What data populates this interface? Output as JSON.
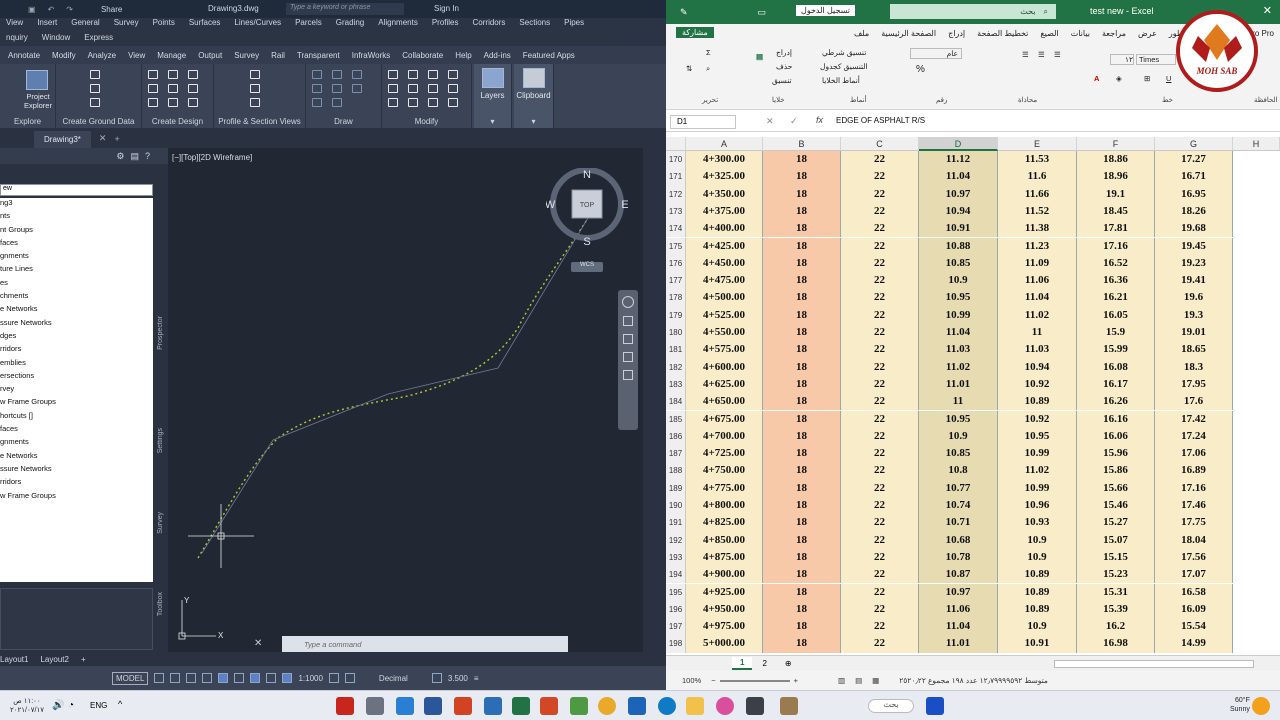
{
  "cad": {
    "doc_name": "Drawing3.dwg",
    "share": "Share",
    "search_placeholder": "Type a keyword or phrase",
    "sign_in": "Sign In",
    "menu_row1": [
      "View",
      "Insert",
      "General",
      "Survey",
      "Points",
      "Surfaces",
      "Lines/Curves",
      "Parcels",
      "Grading",
      "Alignments",
      "Profiles",
      "Corridors",
      "Sections",
      "Pipes"
    ],
    "menu_row2": [
      "nquiry",
      "Window",
      "Express"
    ],
    "ribbon_tabs": [
      "Annotate",
      "Modify",
      "Analyze",
      "View",
      "Manage",
      "Output",
      "Survey",
      "Rail",
      "Transparent",
      "InfraWorks",
      "Collaborate",
      "Help",
      "Add-ins",
      "Featured Apps"
    ],
    "project_explorer": "Project Explorer",
    "layers": "Layers",
    "clipboard": "Clipboard",
    "panels": [
      "Explore",
      "Create Ground Data",
      "Create Design",
      "Profile & Section Views",
      "Draw",
      "Modify"
    ],
    "doc_tab": "Drawing3*",
    "prospector_select": "ew",
    "tree": [
      "ng3",
      "nts",
      "nt Groups",
      "faces",
      "gnments",
      "ture Lines",
      "es",
      "chments",
      "e Networks",
      "ssure Networks",
      "dges",
      "rridors",
      "emblies",
      "ersections",
      "rvey",
      "w Frame Groups",
      "hortcuts []",
      "faces",
      "gnments",
      "e Networks",
      "ssure Networks",
      "rridors",
      "w Frame Groups"
    ],
    "side_labels": [
      "Prospector",
      "Settings",
      "Survey",
      "Toolbox"
    ],
    "viewport_label": "[−][Top][2D Wireframe]",
    "compass": {
      "n": "N",
      "s": "S",
      "e": "E",
      "w": "W",
      "top": "TOP",
      "wcs": "WCS"
    },
    "ucs": {
      "x": "X",
      "y": "Y"
    },
    "command_placeholder": "Type a command",
    "layout_tabs": [
      "Layout1",
      "Layout2"
    ],
    "status": {
      "model": "MODEL",
      "scale": "1:1000",
      "units": "Decimal",
      "value": "3.500"
    }
  },
  "excel": {
    "sign_in": "تسجيل الدخول",
    "search": "بحث",
    "file_name": "test new  -  Excel",
    "share": "مشاركة",
    "tabs": [
      "ملف",
      "الصفحة الرئيسية",
      "إدراج",
      "تخطيط الصفحة",
      "الصيغ",
      "بيانات",
      "مراجعة",
      "عرض",
      "المطور",
      "تعليمات",
      "Nitro Pro"
    ],
    "ribbon": {
      "insert": "إدراج",
      "delete": "حذف",
      "format": "تنسيق",
      "cond": "تنسيق شرطي",
      "table": "التنسيق كجدول",
      "styles": "أنماط الخلايا",
      "general": "عام",
      "font": "Times",
      "size": "١٢"
    },
    "groups": [
      "تحرير",
      "خلايا",
      "أنماط",
      "رقم",
      "محاذاة",
      "خط",
      "الحافظة"
    ],
    "name_box": "D1",
    "formula": "EDGE OF ASPHALT R/S",
    "columns": [
      "A",
      "B",
      "C",
      "D",
      "E",
      "F",
      "G",
      "H"
    ],
    "selected_col": "D",
    "rows": [
      [
        "170",
        "4+300.00",
        "18",
        "22",
        "11.12",
        "11.53",
        "18.86",
        "17.27"
      ],
      [
        "171",
        "4+325.00",
        "18",
        "22",
        "11.04",
        "11.6",
        "18.96",
        "16.71"
      ],
      [
        "172",
        "4+350.00",
        "18",
        "22",
        "10.97",
        "11.66",
        "19.1",
        "16.95"
      ],
      [
        "173",
        "4+375.00",
        "18",
        "22",
        "10.94",
        "11.52",
        "18.45",
        "18.26"
      ],
      [
        "174",
        "4+400.00",
        "18",
        "22",
        "10.91",
        "11.38",
        "17.81",
        "19.68"
      ],
      [
        "175",
        "4+425.00",
        "18",
        "22",
        "10.88",
        "11.23",
        "17.16",
        "19.45"
      ],
      [
        "176",
        "4+450.00",
        "18",
        "22",
        "10.85",
        "11.09",
        "16.52",
        "19.23"
      ],
      [
        "177",
        "4+475.00",
        "18",
        "22",
        "10.9",
        "11.06",
        "16.36",
        "19.41"
      ],
      [
        "178",
        "4+500.00",
        "18",
        "22",
        "10.95",
        "11.04",
        "16.21",
        "19.6"
      ],
      [
        "179",
        "4+525.00",
        "18",
        "22",
        "10.99",
        "11.02",
        "16.05",
        "19.3"
      ],
      [
        "180",
        "4+550.00",
        "18",
        "22",
        "11.04",
        "11",
        "15.9",
        "19.01"
      ],
      [
        "181",
        "4+575.00",
        "18",
        "22",
        "11.03",
        "11.03",
        "15.99",
        "18.65"
      ],
      [
        "182",
        "4+600.00",
        "18",
        "22",
        "11.02",
        "10.94",
        "16.08",
        "18.3"
      ],
      [
        "183",
        "4+625.00",
        "18",
        "22",
        "11.01",
        "10.92",
        "16.17",
        "17.95"
      ],
      [
        "184",
        "4+650.00",
        "18",
        "22",
        "11",
        "10.89",
        "16.26",
        "17.6"
      ],
      [
        "185",
        "4+675.00",
        "18",
        "22",
        "10.95",
        "10.92",
        "16.16",
        "17.42"
      ],
      [
        "186",
        "4+700.00",
        "18",
        "22",
        "10.9",
        "10.95",
        "16.06",
        "17.24"
      ],
      [
        "187",
        "4+725.00",
        "18",
        "22",
        "10.85",
        "10.99",
        "15.96",
        "17.06"
      ],
      [
        "188",
        "4+750.00",
        "18",
        "22",
        "10.8",
        "11.02",
        "15.86",
        "16.89"
      ],
      [
        "189",
        "4+775.00",
        "18",
        "22",
        "10.77",
        "10.99",
        "15.66",
        "17.16"
      ],
      [
        "190",
        "4+800.00",
        "18",
        "22",
        "10.74",
        "10.96",
        "15.46",
        "17.46"
      ],
      [
        "191",
        "4+825.00",
        "18",
        "22",
        "10.71",
        "10.93",
        "15.27",
        "17.75"
      ],
      [
        "192",
        "4+850.00",
        "18",
        "22",
        "10.68",
        "10.9",
        "15.07",
        "18.04"
      ],
      [
        "193",
        "4+875.00",
        "18",
        "22",
        "10.78",
        "10.9",
        "15.15",
        "17.56"
      ],
      [
        "194",
        "4+900.00",
        "18",
        "22",
        "10.87",
        "10.89",
        "15.23",
        "17.07"
      ],
      [
        "195",
        "4+925.00",
        "18",
        "22",
        "10.97",
        "10.89",
        "15.31",
        "16.58"
      ],
      [
        "196",
        "4+950.00",
        "18",
        "22",
        "11.06",
        "10.89",
        "15.39",
        "16.09"
      ],
      [
        "197",
        "4+975.00",
        "18",
        "22",
        "11.04",
        "10.9",
        "16.2",
        "15.54"
      ],
      [
        "198",
        "5+000.00",
        "18",
        "22",
        "11.01",
        "10.91",
        "16.98",
        "14.99"
      ]
    ],
    "sheets": [
      "1",
      "2"
    ],
    "status_zoom": "100%",
    "status_text": "متوسط ١٢٫٧٩٩٩٩٥٩٢   عدد ١٩٨   مجموع ٢٥٢٠٫٢٢",
    "logo_text": "MOH SAB"
  },
  "taskbar": {
    "lang": "ENG",
    "time": "١١:٠٠ ص",
    "date": "٢٠٢١/٠٧/١٧",
    "weather_temp": "60°F",
    "weather_text": "Sunny",
    "search": "بحث"
  }
}
